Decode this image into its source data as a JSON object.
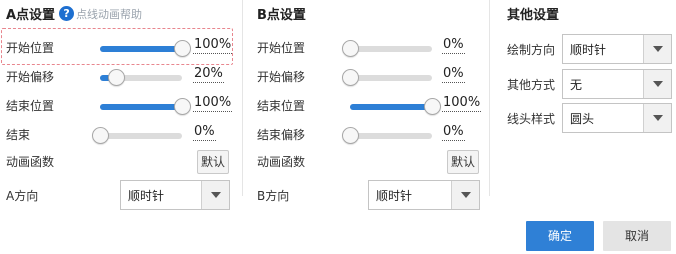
{
  "colors": {
    "accent": "#2d7fd6",
    "track": "#dcdcdc",
    "highlight_dashed_border": "#e8868e",
    "ok_button": "#2f80d6",
    "cancel_button": "#e4e4e4"
  },
  "panel_a": {
    "title": "A点设置",
    "help_icon": "question-circle-icon",
    "help_text": "点线动画帮助",
    "sliders": [
      {
        "label": "开始位置",
        "value_text": "100%",
        "fraction": 1.0,
        "highlighted": true
      },
      {
        "label": "开始偏移",
        "value_text": "20%",
        "fraction": 0.2
      },
      {
        "label": "结束位置",
        "value_text": "100%",
        "fraction": 1.0
      },
      {
        "label": "结束",
        "value_text": "0%",
        "fraction": 0.0
      }
    ],
    "easing_label": "动画函数",
    "easing_button": "默认",
    "direction_label": "A方向",
    "direction_value": "顺时针"
  },
  "panel_b": {
    "title": "B点设置",
    "sliders": [
      {
        "label": "开始位置",
        "value_text": "0%",
        "fraction": 0.0
      },
      {
        "label": "开始偏移",
        "value_text": "0%",
        "fraction": 0.0
      },
      {
        "label": "结束位置",
        "value_text": "100%",
        "fraction": 1.0
      },
      {
        "label": "结束偏移",
        "value_text": "0%",
        "fraction": 0.0
      }
    ],
    "easing_label": "动画函数",
    "easing_button": "默认",
    "direction_label": "B方向",
    "direction_value": "顺时针"
  },
  "panel_other": {
    "title": "其他设置",
    "fields": [
      {
        "label": "绘制方向",
        "value": "顺时针"
      },
      {
        "label": "其他方式",
        "value": "无"
      },
      {
        "label": "线头样式",
        "value": "圆头"
      }
    ]
  },
  "footer": {
    "ok_label": "确定",
    "cancel_label": "取消"
  }
}
